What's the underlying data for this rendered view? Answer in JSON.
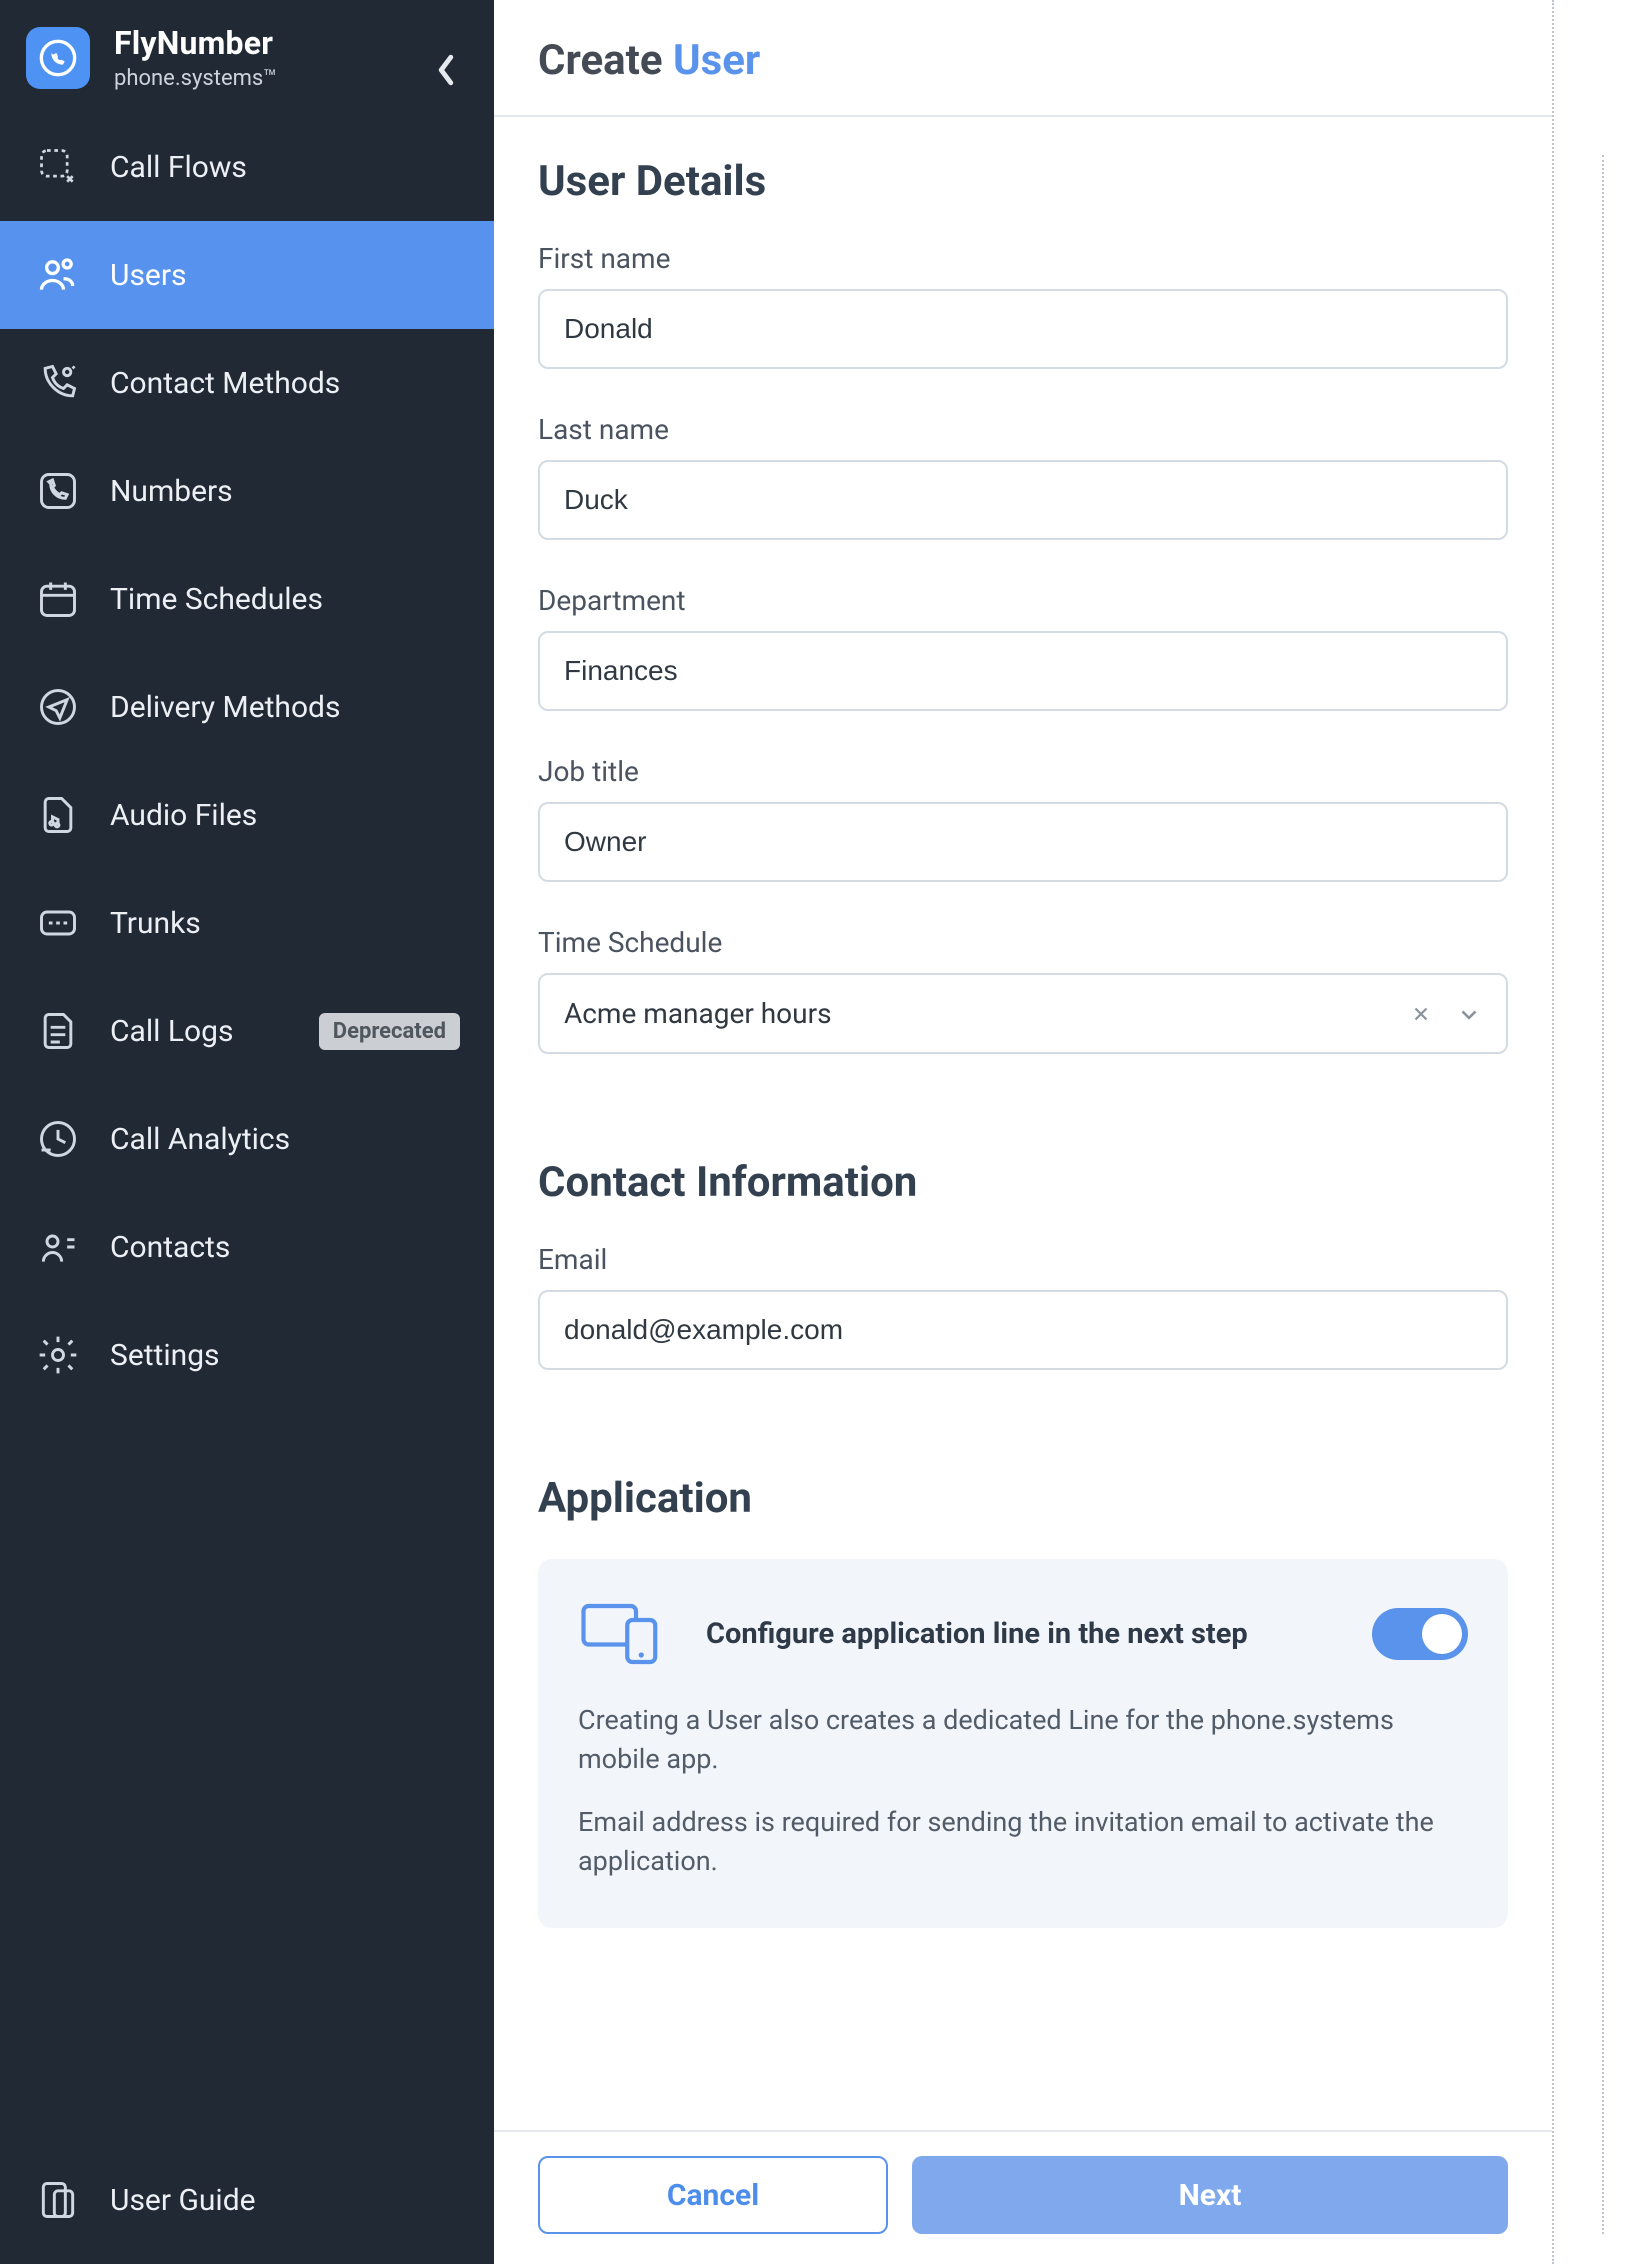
{
  "brand": {
    "title": "FlyNumber",
    "subtitle": "phone.systems™"
  },
  "sidebar": {
    "items": [
      {
        "label": "Call Flows",
        "icon": "flow-icon"
      },
      {
        "label": "Users",
        "icon": "users-icon",
        "active": true
      },
      {
        "label": "Contact Methods",
        "icon": "contact-methods-icon"
      },
      {
        "label": "Numbers",
        "icon": "numbers-icon"
      },
      {
        "label": "Time Schedules",
        "icon": "schedule-icon"
      },
      {
        "label": "Delivery Methods",
        "icon": "delivery-icon"
      },
      {
        "label": "Audio Files",
        "icon": "audio-icon"
      },
      {
        "label": "Trunks",
        "icon": "trunks-icon"
      },
      {
        "label": "Call Logs",
        "icon": "logs-icon",
        "badge": "Deprecated"
      },
      {
        "label": "Call Analytics",
        "icon": "analytics-icon"
      },
      {
        "label": "Contacts",
        "icon": "contacts-icon"
      },
      {
        "label": "Settings",
        "icon": "settings-icon"
      }
    ],
    "footer": {
      "label": "User Guide",
      "icon": "guide-icon"
    }
  },
  "page": {
    "title_prefix": "Create ",
    "title_accent": "User",
    "sections": {
      "user_details": {
        "heading": "User Details",
        "first_name": {
          "label": "First name",
          "value": "Donald"
        },
        "last_name": {
          "label": "Last name",
          "value": "Duck"
        },
        "department": {
          "label": "Department",
          "value": "Finances"
        },
        "job_title": {
          "label": "Job title",
          "value": "Owner"
        },
        "time_schedule": {
          "label": "Time Schedule",
          "value": "Acme manager hours"
        }
      },
      "contact": {
        "heading": "Contact Information",
        "email": {
          "label": "Email",
          "value": "donald@example.com"
        }
      },
      "application": {
        "heading": "Application",
        "configure_label": "Configure application line in the next step",
        "toggle_on": true,
        "para1": "Creating a User also creates a dedicated Line for the phone.systems mobile app.",
        "para2": "Email address is required for sending the invitation email to activate the application."
      }
    },
    "buttons": {
      "cancel": "Cancel",
      "next": "Next"
    }
  }
}
